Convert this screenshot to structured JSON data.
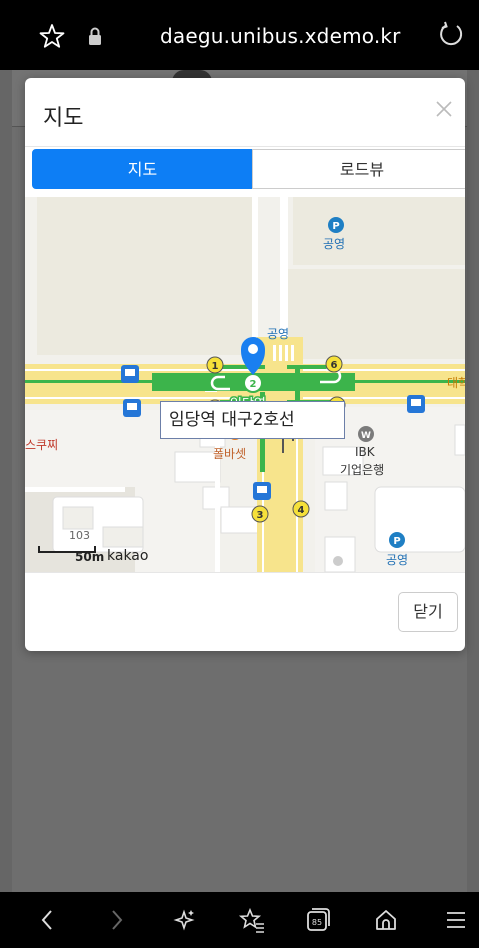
{
  "browser": {
    "url": "daegu.unibus.xdemo.kr",
    "icons": [
      "star-icon",
      "lock-icon",
      "reload-icon"
    ]
  },
  "bottom_nav": {
    "icons": [
      "back-icon",
      "forward-icon",
      "sparkle-icon",
      "bookmarks-icon",
      "tabs-icon",
      "home-icon",
      "menu-icon"
    ],
    "tab_count": "85"
  },
  "modal": {
    "title": "지도",
    "tabs": [
      {
        "label": "지도",
        "active": true
      },
      {
        "label": "로드뷰",
        "active": false
      }
    ],
    "close_button": "닫기",
    "accent_color": "#0d7ef5"
  },
  "map": {
    "station_label": "임당역 대구2호선",
    "station_name": "임당역",
    "pois": {
      "parking_top": "공영",
      "parking_bottom": "공영",
      "gongyeong_top": "공영",
      "daehakro": "대학로",
      "pizza": "스쿠찌",
      "paul_bassett": "폴바셋",
      "bank_line1": "IBK",
      "bank_line2": "기업은행",
      "building": "103"
    },
    "exits": [
      "1",
      "2",
      "3",
      "4",
      "5",
      "6"
    ],
    "scale": "50m",
    "provider": "kakao",
    "colors": {
      "road": "#f7e48c",
      "line2": "#3cb44b",
      "marker": "#1a7ff0",
      "exit": "#f5e03a"
    }
  }
}
